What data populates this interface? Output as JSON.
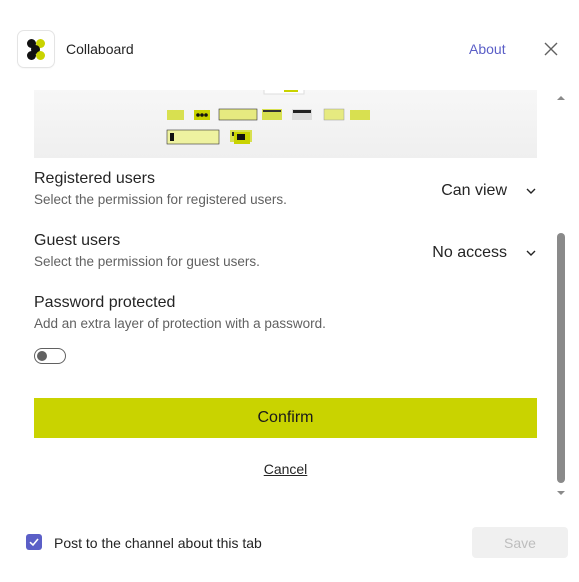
{
  "app": {
    "title": "Collaboard",
    "about_label": "About"
  },
  "permissions": [
    {
      "title": "Registered users",
      "description": "Select the permission for registered users.",
      "value": "Can view"
    },
    {
      "title": "Guest users",
      "description": "Select the permission for guest users.",
      "value": "No access"
    }
  ],
  "password": {
    "title": "Password protected",
    "description": "Add an extra layer of protection with a password.",
    "enabled": false
  },
  "actions": {
    "confirm_label": "Confirm",
    "cancel_label": "Cancel"
  },
  "footer": {
    "checkbox_label": "Post to the channel about this tab",
    "checkbox_checked": true,
    "save_label": "Save"
  },
  "colors": {
    "accent": "#c9d300",
    "link": "#5b5fc7",
    "text": "#242424",
    "muted": "#616161"
  },
  "icons": {
    "logo": "collaboard-logo-icon",
    "close": "close-icon",
    "dropdown": "chevron-down-icon",
    "check": "checkmark-icon"
  }
}
